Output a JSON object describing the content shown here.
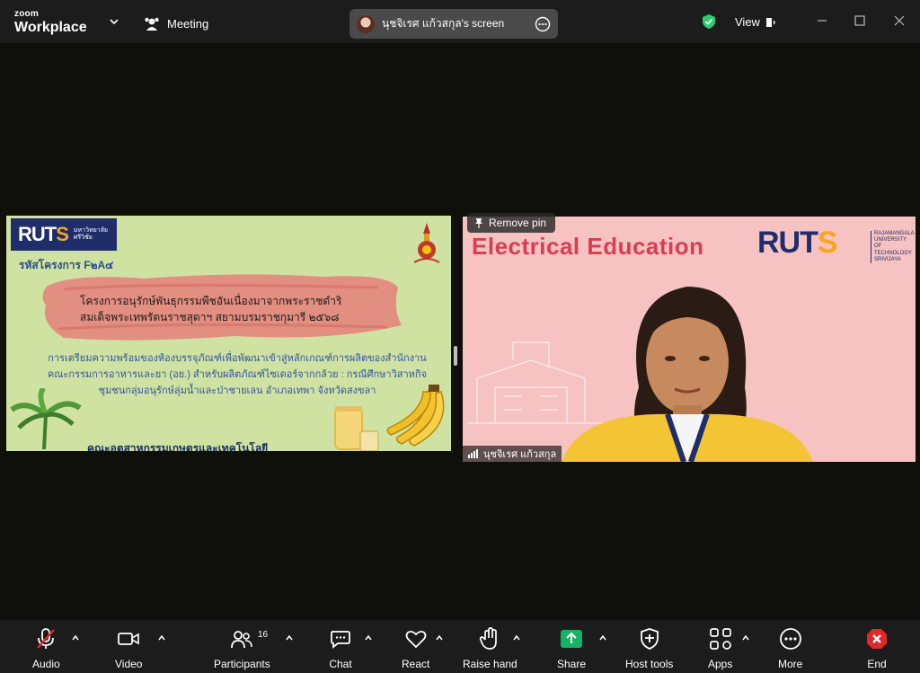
{
  "titlebar": {
    "logo_top": "zoom",
    "logo_bottom": "Workplace",
    "meeting_label": "Meeting",
    "share_label": "นุชจิเรศ แก้วสกุล's screen",
    "view_label": "View"
  },
  "slide": {
    "ruts_logo": "RUTS",
    "ruts_sub": "มหาวิทยาลัย ศรีวิชัย",
    "project_code": "รหัสโครงการ F๒A๔",
    "title_line1": "โครงการอนุรักษ์พันธุกรรมพืชอันเนื่องมาจากพระราชดำริ",
    "title_line2": "สมเด็จพระเทพรัตนราชสุดาฯ สยามบรมราชกุมารี ๒๕๖๘",
    "desc_line1": "การเตรียมความพร้อมของห้องบรรจุภัณฑ์เพื่อพัฒนาเข้าสู่หลักเกณฑ์การผลิตของสำนักงาน",
    "desc_line2": "คณะกรรมการอาหารและยา (อย.) สำหรับผลิตภัณฑ์ไซเดอร์จากกล้วย : กรณีศึกษาวิสาหกิจ",
    "desc_line3": "ชุมชนกลุ่มอนุรักษ์ลุ่มน้ำและป่าชายเลน อำเภอเทพา จังหวัดสงขลา",
    "faculty": "คณะอุตสาหกรรมเกษตรและเทคโนโลยี"
  },
  "video": {
    "remove_pin": "Remove pin",
    "banner_title": "Electrical Education",
    "ruts_logo": "RUTS",
    "ruts_sub": "RAJAMANGALA UNIVERSITY OF TECHNOLOGY SRIVIJAYA",
    "participant_name": "นุชจิเรศ แก้วสกุล"
  },
  "toolbar": {
    "audio": "Audio",
    "video": "Video",
    "participants": "Participants",
    "participants_count": "16",
    "chat": "Chat",
    "react": "React",
    "raise_hand": "Raise hand",
    "share": "Share",
    "host_tools": "Host tools",
    "apps": "Apps",
    "more": "More",
    "end": "End"
  },
  "colors": {
    "share_green": "#16b364",
    "end_red": "#e02828",
    "ruts_navy": "#1f2d6b",
    "ruts_orange": "#f5a623"
  }
}
